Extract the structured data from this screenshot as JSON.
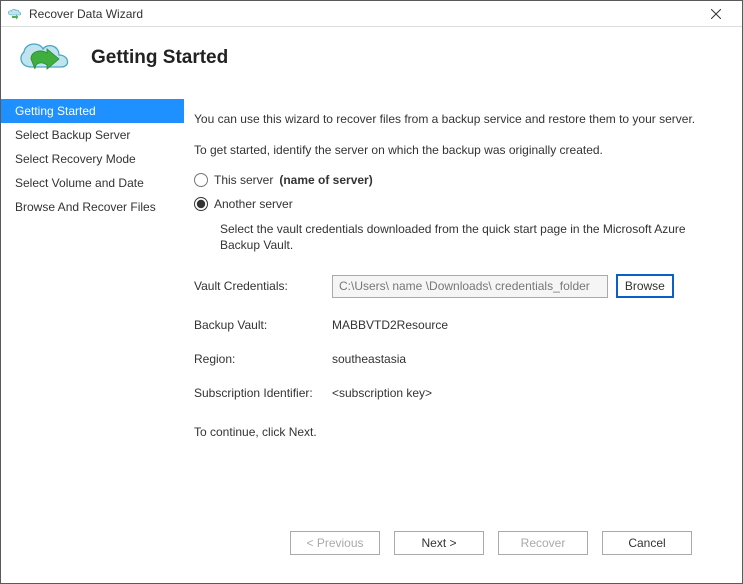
{
  "title": "Recover Data Wizard",
  "header": {
    "heading": "Getting Started"
  },
  "sidebar": {
    "items": [
      {
        "label": "Getting Started",
        "selected": true
      },
      {
        "label": "Select Backup Server",
        "selected": false
      },
      {
        "label": "Select Recovery Mode",
        "selected": false
      },
      {
        "label": "Select Volume and Date",
        "selected": false
      },
      {
        "label": "Browse And Recover Files",
        "selected": false
      }
    ]
  },
  "content": {
    "intro": "You can use this wizard to recover files from a backup service and restore them to your server.",
    "identify": "To get started, identify the server on which the backup was originally created.",
    "radios": {
      "this_server_label": "This server",
      "this_server_name": "(name of server)",
      "another_server_label": "Another server",
      "selected": "another"
    },
    "instruction": "Select the vault credentials downloaded from the quick start page in the Microsoft Azure Backup Vault.",
    "vault_credentials": {
      "label": "Vault Credentials:",
      "value": "C:\\Users\\ name \\Downloads\\ credentials_folder",
      "browse": "Browse"
    },
    "fields": {
      "backup_vault_label": "Backup Vault:",
      "backup_vault_value": "MABBVTD2Resource",
      "region_label": "Region:",
      "region_value": "southeastasia",
      "sub_id_label": "Subscription Identifier:",
      "sub_id_value": "<subscription key>"
    },
    "continue": "To continue, click Next."
  },
  "footer": {
    "previous": "< Previous",
    "next": "Next >",
    "recover": "Recover",
    "cancel": "Cancel"
  }
}
